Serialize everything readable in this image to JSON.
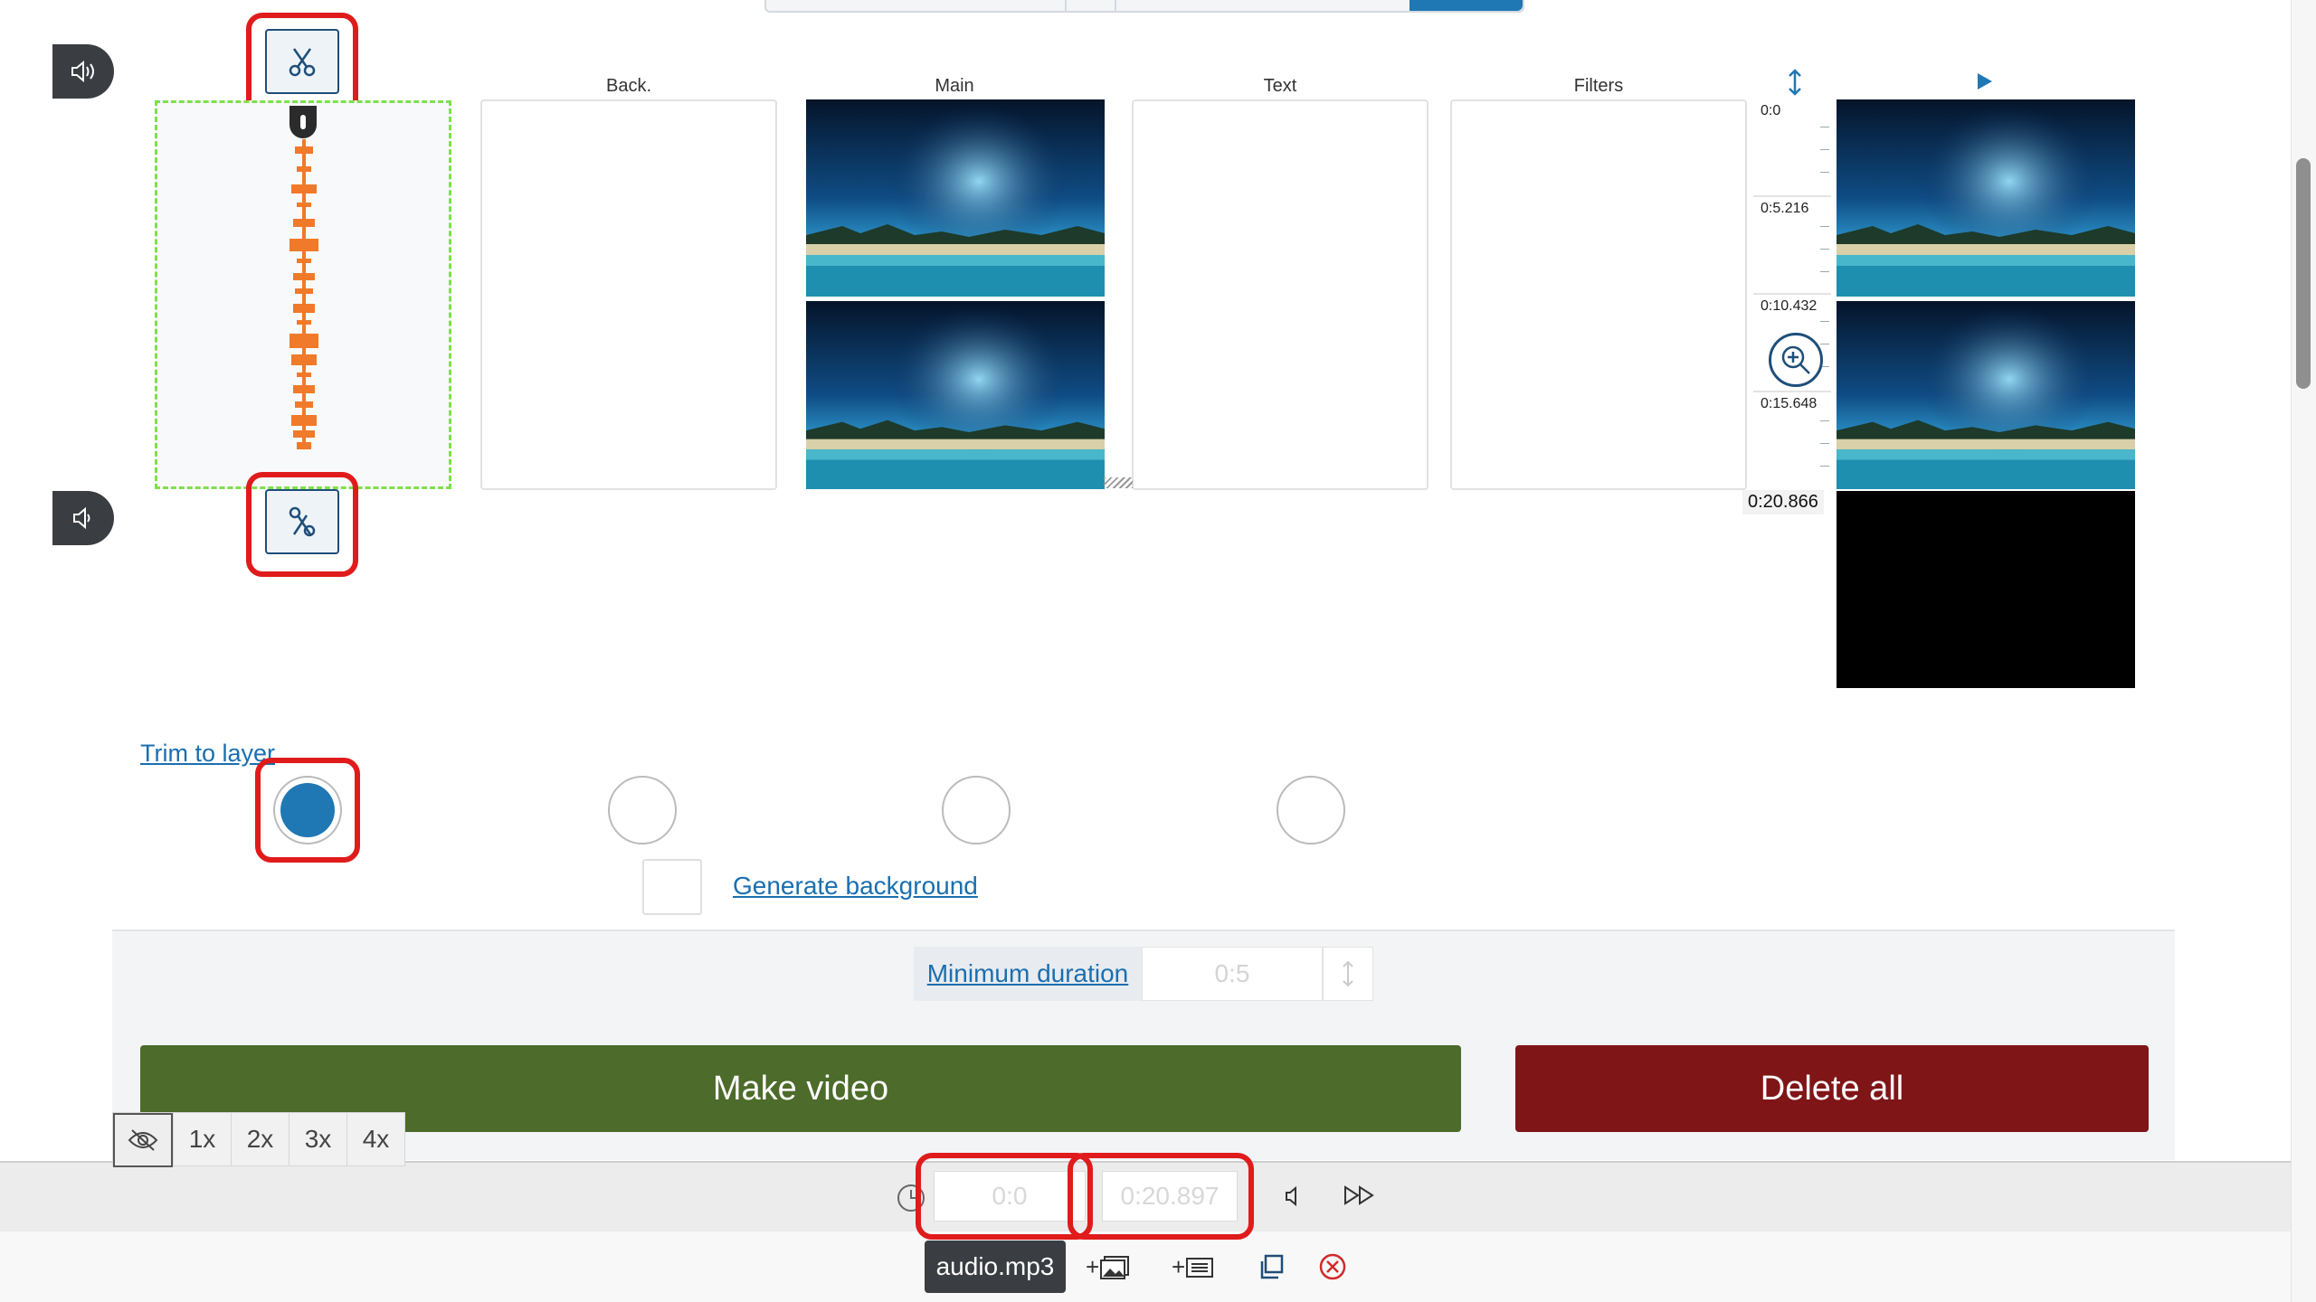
{
  "columns": {
    "back": "Back.",
    "main": "Main",
    "text": "Text",
    "filters": "Filters"
  },
  "ruler": {
    "marks": [
      "0:0",
      "0:5.216",
      "0:10.432",
      "0:15.648"
    ],
    "end": "0:20.866"
  },
  "links": {
    "trim_to_layer": "Trim to layer",
    "generate_background": "Generate background",
    "minimum_duration": "Minimum duration"
  },
  "inputs": {
    "minimum_duration_value": "0:5",
    "start_time": "0:0",
    "end_time": "0:20.897"
  },
  "buttons": {
    "make_video": "Make video",
    "delete_all": "Delete all"
  },
  "speeds": [
    "1x",
    "2x",
    "3x",
    "4x"
  ],
  "track": {
    "filename": "audio.mp3"
  },
  "colors": {
    "accent_blue": "#1f78b4",
    "make_green": "#4d6b2a",
    "delete_red": "#7f1517",
    "highlight_red": "#e01b1b",
    "waveform_orange": "#f07a2a",
    "dash_green": "#7ee04b"
  }
}
